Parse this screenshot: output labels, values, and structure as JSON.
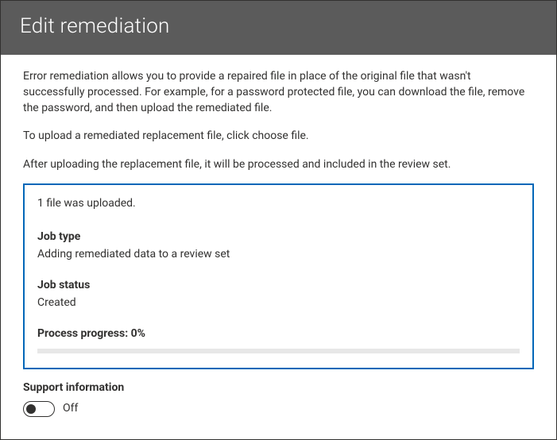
{
  "header": {
    "title": "Edit remediation"
  },
  "intro": {
    "p1": "Error remediation allows you to provide a repaired file in place of the original file that wasn't successfully processed. For example, for a password protected file, you can download the file, remove the password, and then upload the remediated file.",
    "p2": "To upload a remediated replacement file, click choose file.",
    "p3": "After uploading the replacement file, it will be processed and included in the review set."
  },
  "status": {
    "uploaded_msg": "1 file was uploaded.",
    "job_type_label": "Job type",
    "job_type_value": "Adding remediated data to a review set",
    "job_status_label": "Job status",
    "job_status_value": "Created",
    "progress_label": "Process progress: 0%",
    "progress_percent": 0
  },
  "support": {
    "label": "Support information",
    "state": "Off",
    "on": false
  }
}
